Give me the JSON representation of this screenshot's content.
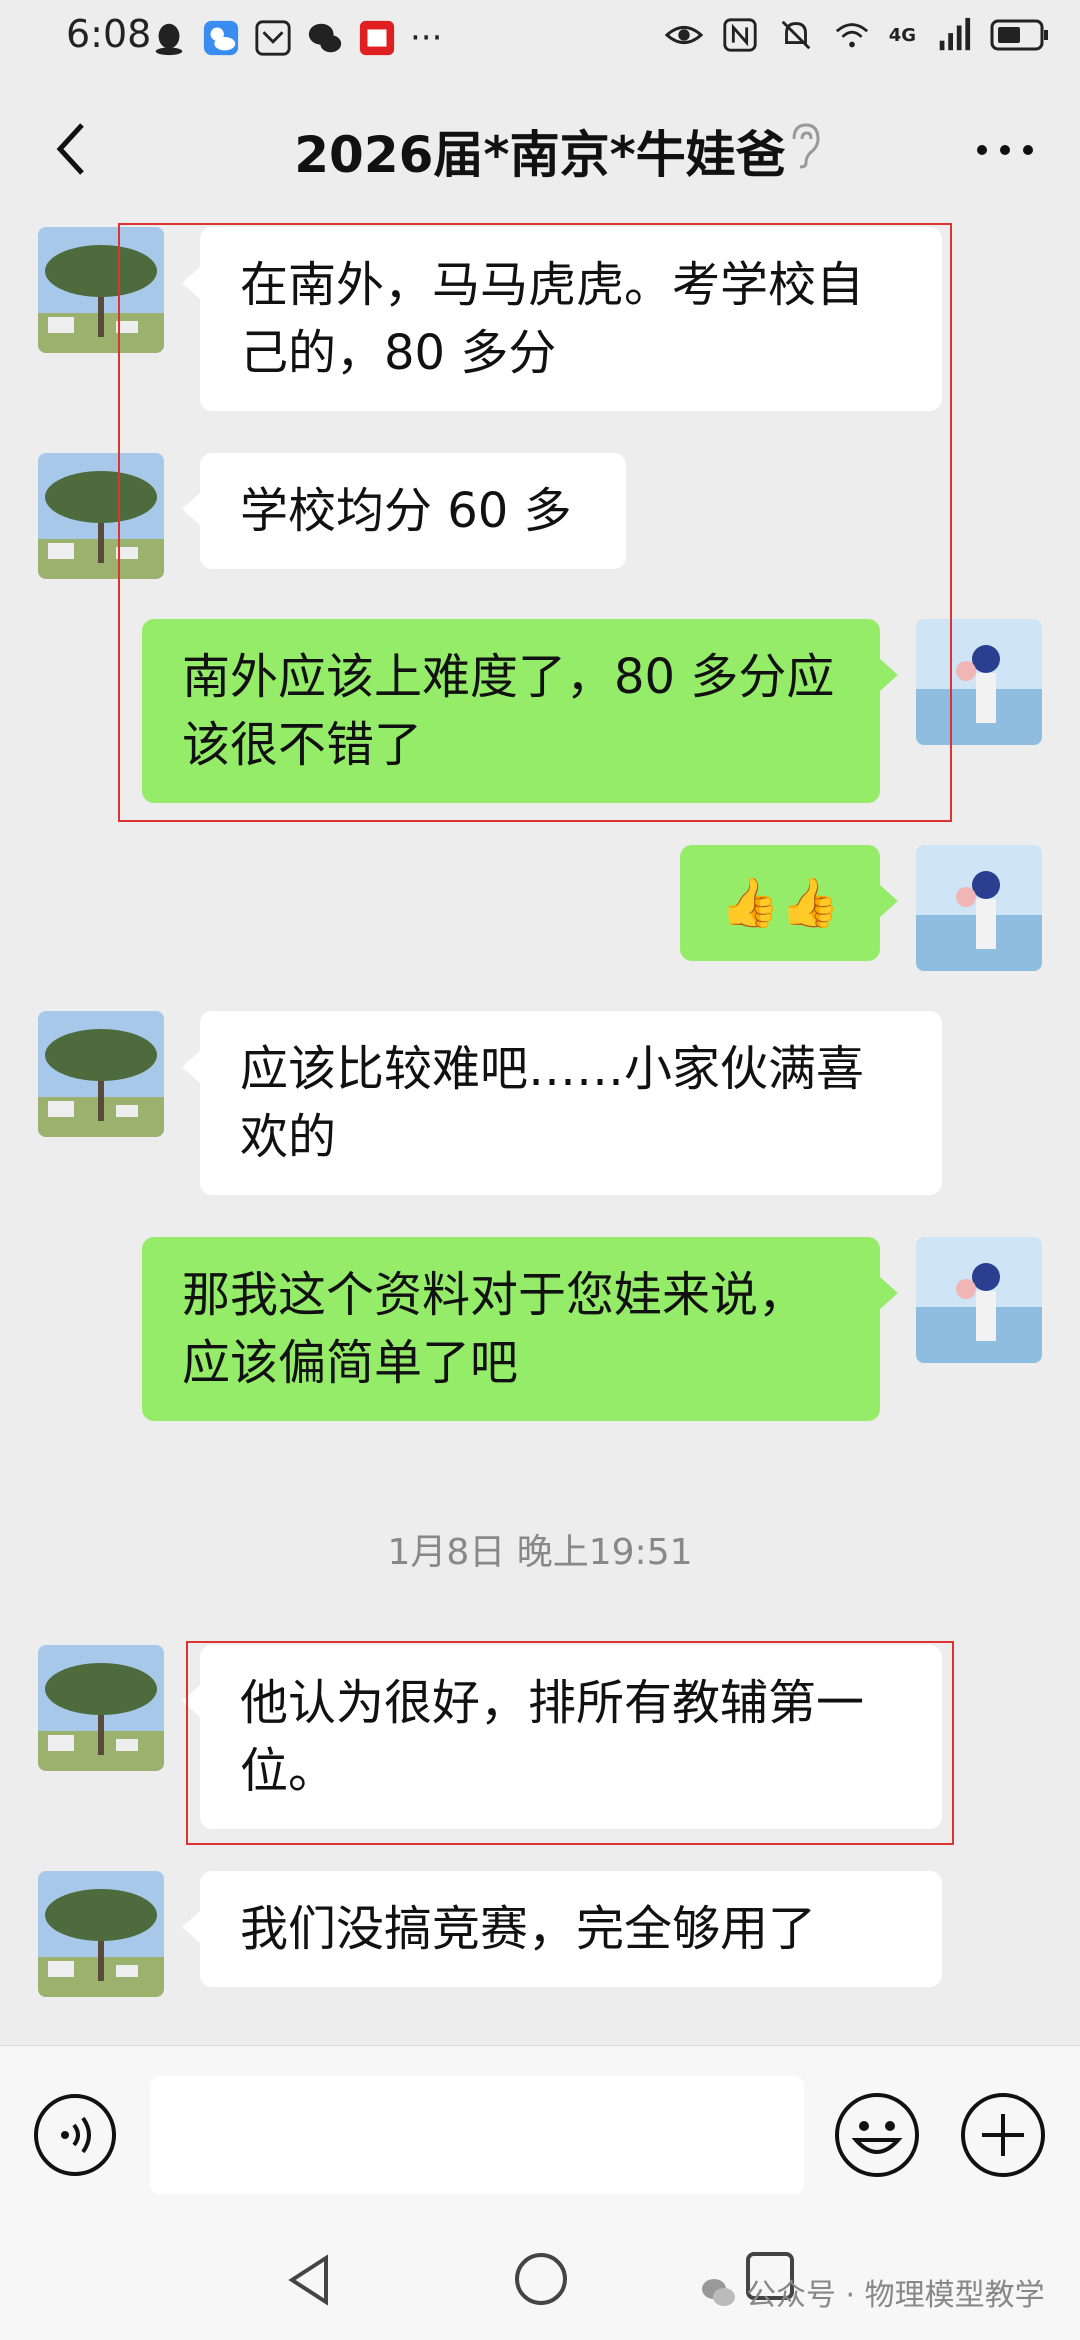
{
  "status_bar": {
    "time": "6:08",
    "network": "4G",
    "icons_left": [
      "qq-icon",
      "weather-icon",
      "app-icon",
      "wechat-icon",
      "video-icon",
      "more-dots-icon"
    ],
    "icons_right": [
      "eye-icon",
      "nfc-icon",
      "mute-icon",
      "wifi-icon",
      "signal-icon",
      "battery-icon"
    ]
  },
  "header": {
    "title": "2026届*南京*牛娃爸",
    "back_icon": "chevron-left-icon",
    "ear_icon": "ear-icon",
    "more_icon": "more-icon"
  },
  "messages": [
    {
      "side": "left",
      "text": "在南外，马马虎虎。考学校自己的，80 多分"
    },
    {
      "side": "left",
      "text": "学校均分 60 多"
    },
    {
      "side": "right",
      "text": "南外应该上难度了，80 多分应该很不错了"
    },
    {
      "side": "right",
      "text": "👍👍"
    },
    {
      "side": "left",
      "text": "应该比较难吧……小家伙满喜欢的"
    },
    {
      "side": "right",
      "text": "那我这个资料对于您娃来说，应该偏简单了吧"
    },
    {
      "side": "left",
      "text": "他认为很好，排所有教辅第一位。"
    },
    {
      "side": "left",
      "text": "我们没搞竞赛，完全够用了"
    }
  ],
  "timestamp": "1月8日 晚上19:51",
  "input_bar": {
    "voice_icon": "voice-icon",
    "emoji_icon": "emoji-icon",
    "plus_icon": "plus-icon"
  },
  "watermark": "公众号 · 物理模型教学",
  "colors": {
    "background": "#ededed",
    "bubble_self": "#95ec69",
    "bubble_other": "#ffffff",
    "highlight": "#dd3333"
  }
}
